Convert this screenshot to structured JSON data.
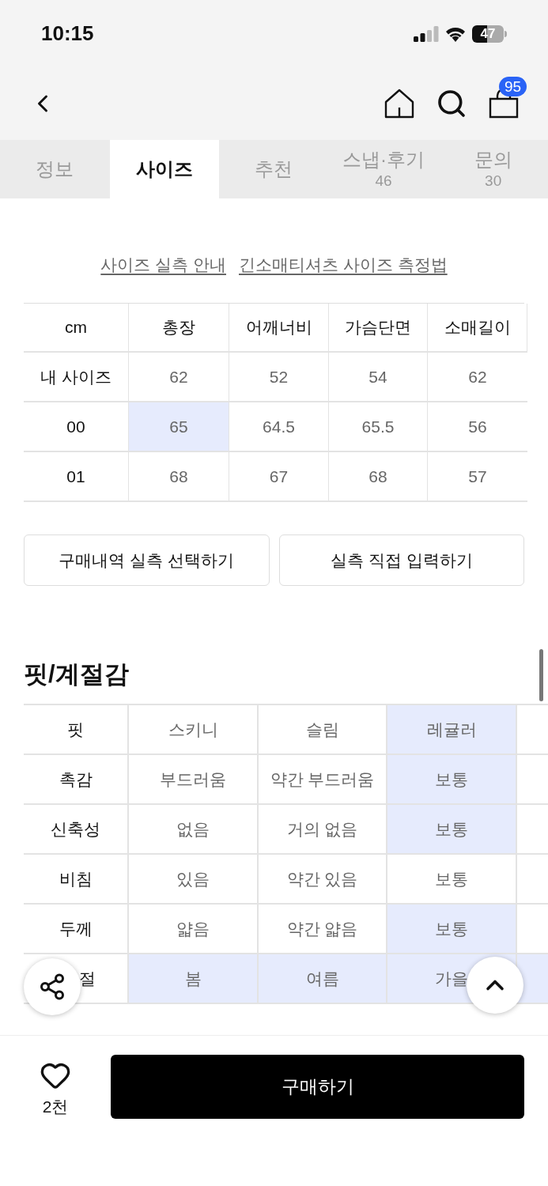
{
  "status_bar": {
    "time": "10:15",
    "battery": "47"
  },
  "nav": {
    "cart_count": "95"
  },
  "tabs": [
    {
      "label": "정보",
      "selected": false
    },
    {
      "label": "사이즈",
      "selected": true
    },
    {
      "label": "추천",
      "selected": false
    },
    {
      "label": "스냅·후기",
      "count": "46",
      "selected": false
    },
    {
      "label": "문의",
      "count": "30",
      "selected": false
    }
  ],
  "links": [
    "사이즈 실측 안내",
    "긴소매티셔츠 사이즈 측정법"
  ],
  "size_table": {
    "corner": "cm",
    "columns": [
      "총장",
      "어깨너비",
      "가슴단면",
      "소매길이"
    ],
    "rows": [
      {
        "label": "내 사이즈",
        "cells": [
          {
            "text": "62",
            "selected": false
          },
          {
            "text": "52",
            "selected": false
          },
          {
            "text": "54",
            "selected": false
          },
          {
            "text": "62",
            "selected": false
          }
        ]
      },
      {
        "label": "00",
        "cells": [
          {
            "text": "65",
            "selected": true
          },
          {
            "text": "64.5",
            "selected": false
          },
          {
            "text": "65.5",
            "selected": false
          },
          {
            "text": "56",
            "selected": false
          }
        ]
      },
      {
        "label": "01",
        "cells": [
          {
            "text": "68",
            "selected": false
          },
          {
            "text": "67",
            "selected": false
          },
          {
            "text": "68",
            "selected": false
          },
          {
            "text": "57",
            "selected": false
          }
        ]
      }
    ]
  },
  "size_buttons": [
    "구매내역 실측 선택하기",
    "실측 직접 입력하기"
  ],
  "fit_section": {
    "title": "핏/계절감",
    "rows": [
      {
        "label": "핏",
        "cells": [
          {
            "text": "스키니",
            "selected": false
          },
          {
            "text": "슬림",
            "selected": false
          },
          {
            "text": "레귤러",
            "selected": true
          },
          {
            "selected": false
          }
        ]
      },
      {
        "label": "촉감",
        "cells": [
          {
            "text": "부드러움",
            "selected": false
          },
          {
            "text": "약간 부드러움",
            "selected": false
          },
          {
            "text": "보통",
            "selected": true
          },
          {
            "selected": false
          }
        ]
      },
      {
        "label": "신축성",
        "cells": [
          {
            "text": "없음",
            "selected": false
          },
          {
            "text": "거의 없음",
            "selected": false
          },
          {
            "text": "보통",
            "selected": true
          },
          {
            "selected": false
          }
        ]
      },
      {
        "label": "비침",
        "cells": [
          {
            "text": "있음",
            "selected": false
          },
          {
            "text": "약간 있음",
            "selected": false
          },
          {
            "text": "보통",
            "selected": false
          },
          {
            "selected": false
          }
        ]
      },
      {
        "label": "두께",
        "cells": [
          {
            "text": "얇음",
            "selected": false
          },
          {
            "text": "약간 얇음",
            "selected": false
          },
          {
            "text": "보통",
            "selected": true
          },
          {
            "selected": false
          }
        ]
      },
      {
        "label": "절",
        "cells": [
          {
            "text": "봄",
            "selected": true
          },
          {
            "text": "여름",
            "selected": true
          },
          {
            "text": "가을",
            "selected": true
          },
          {
            "selected": true
          }
        ]
      }
    ]
  },
  "bottom_bar": {
    "like_count": "2천",
    "buy_label": "구매하기"
  }
}
